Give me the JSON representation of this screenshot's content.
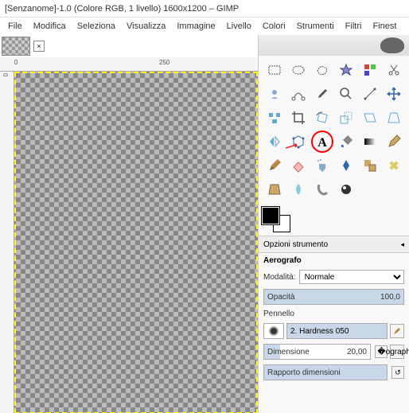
{
  "title": "[Senzanome]-1.0 (Colore RGB, 1 livello) 1600x1200 – GIMP",
  "menu": {
    "file": "File",
    "modifica": "Modifica",
    "seleziona": "Seleziona",
    "visualizza": "Visualizza",
    "immagine": "Immagine",
    "livello": "Livello",
    "colori": "Colori",
    "strumenti": "Strumenti",
    "filtri": "Filtri",
    "finest": "Finest"
  },
  "ruler": {
    "h0": "0",
    "h250": "250",
    "v0": "0"
  },
  "tools": {
    "rect_select": "rect-select",
    "ellipse_select": "ellipse-select",
    "free_select": "free-select",
    "fuzzy_select": "fuzzy-select",
    "by_color": "by-color-select",
    "scissors": "scissors",
    "foreground": "foreground-select",
    "paths": "paths",
    "color_picker": "color-picker",
    "zoom": "zoom",
    "measure": "measure",
    "move": "move",
    "align": "align",
    "crop": "crop",
    "rotate": "rotate",
    "scale": "scale",
    "shear": "shear",
    "perspective": "perspective",
    "flip": "flip",
    "cage": "cage",
    "text": "text",
    "bucket": "bucket-fill",
    "blend": "blend",
    "pencil": "pencil",
    "paintbrush": "paintbrush",
    "eraser": "eraser",
    "airbrush": "airbrush",
    "ink": "ink",
    "clone": "clone",
    "heal": "heal",
    "perspective_clone": "perspective-clone",
    "blur": "blur-sharpen",
    "smudge": "smudge",
    "dodge": "dodge-burn"
  },
  "options": {
    "header": "Opzioni strumento",
    "tool_name": "Aerografo",
    "mode_label": "Modalità:",
    "mode_value": "Normale",
    "opacity_label": "Opacità",
    "opacity_value": "100,0",
    "brush_label": "Pennello",
    "brush_name": "2. Hardness 050",
    "size_label": "Dimensione",
    "size_value": "20,00",
    "ratio_label": "Rapporto dimensioni"
  }
}
